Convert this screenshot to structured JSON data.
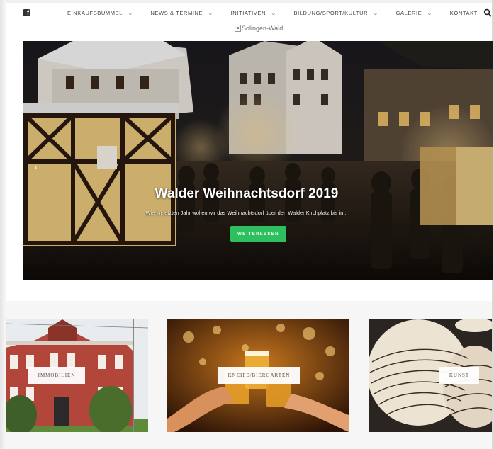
{
  "nav": {
    "social_icon": "facebook-icon",
    "items": [
      {
        "label": "EINKAUFSBUMMEL",
        "has_dropdown": true
      },
      {
        "label": "NEWS & TERMINE",
        "has_dropdown": true
      },
      {
        "label": "INITIATIVEN",
        "has_dropdown": true
      },
      {
        "label": "BILDUNG/SPORT/KULTUR",
        "has_dropdown": true
      },
      {
        "label": "GALERIE",
        "has_dropdown": true
      },
      {
        "label": "KONTAKT",
        "has_dropdown": false
      }
    ],
    "search_icon": "search-icon"
  },
  "logo": {
    "alt_text": "Solingen-Wald"
  },
  "hero": {
    "title": "Walder Weihnachtsdorf 2019",
    "excerpt": "Wie im letzten Jahr wollen wir das Weihnachtsdorf über den Walder Kirchplatz bis in...",
    "button_label": "WEITERLESEN",
    "prev_arrow": "‹"
  },
  "tiles": [
    {
      "label": "IMMOBILIEN"
    },
    {
      "label": "KNEIPE/BIERGARTEN"
    },
    {
      "label": "KUNST"
    }
  ],
  "colors": {
    "accent_green": "#2ebf5f",
    "hero_dark": "#1a1410"
  }
}
